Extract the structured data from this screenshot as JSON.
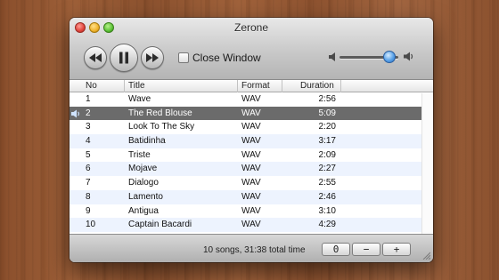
{
  "window": {
    "title": "Zerone"
  },
  "controls": {
    "prev_icon": "rewind-icon",
    "pause_icon": "pause-icon",
    "next_icon": "fast-forward-icon",
    "close_window_checked": false,
    "close_window_label": "Close Window",
    "volume_level": 0.85
  },
  "table": {
    "columns": {
      "no": "No",
      "title": "Title",
      "format": "Format",
      "duration": "Duration"
    },
    "now_playing_index": 1,
    "rows": [
      {
        "no": "1",
        "title": "Wave",
        "format": "WAV",
        "duration": "2:56"
      },
      {
        "no": "2",
        "title": "The Red Blouse",
        "format": "WAV",
        "duration": "5:09"
      },
      {
        "no": "3",
        "title": "Look To The Sky",
        "format": "WAV",
        "duration": "2:20"
      },
      {
        "no": "4",
        "title": "Batidinha",
        "format": "WAV",
        "duration": "3:17"
      },
      {
        "no": "5",
        "title": "Triste",
        "format": "WAV",
        "duration": "2:09"
      },
      {
        "no": "6",
        "title": "Mojave",
        "format": "WAV",
        "duration": "2:27"
      },
      {
        "no": "7",
        "title": "Dialogo",
        "format": "WAV",
        "duration": "2:55"
      },
      {
        "no": "8",
        "title": "Lamento",
        "format": "WAV",
        "duration": "2:46"
      },
      {
        "no": "9",
        "title": "Antigua",
        "format": "WAV",
        "duration": "3:10"
      },
      {
        "no": "10",
        "title": "Captain Bacardi",
        "format": "WAV",
        "duration": "4:29"
      }
    ]
  },
  "status": {
    "summary": "10 songs, 31:38 total time",
    "buttons": [
      "0",
      "−",
      "+"
    ]
  },
  "colors": {
    "selected_row": "#6b6b6b",
    "alt_row": "#edf3fe",
    "volume_knob": "#5aa2e8"
  }
}
